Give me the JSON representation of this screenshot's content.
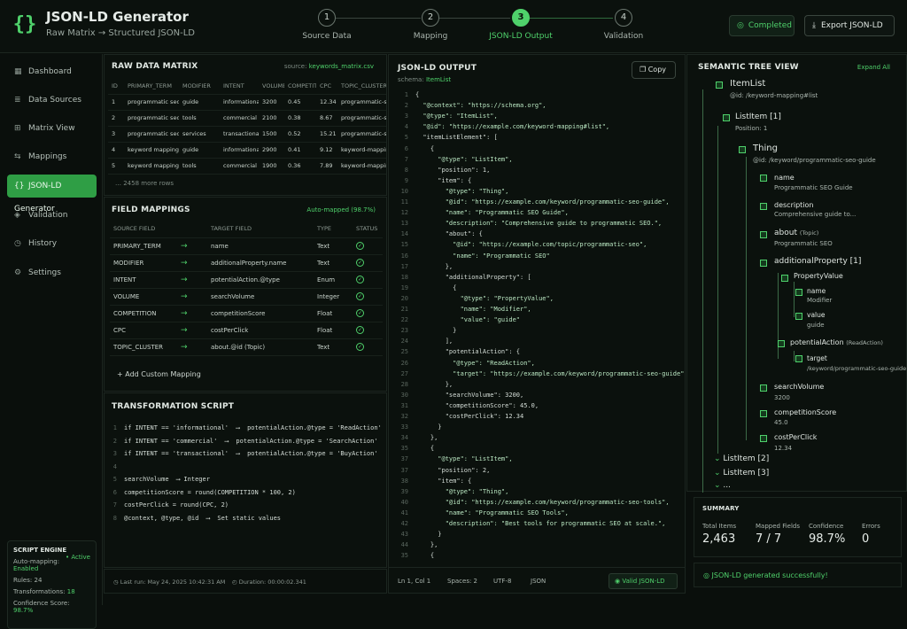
{
  "app": {
    "title": "JSON-LD Generator",
    "subtitle": "Raw Matrix → Structured JSON-LD",
    "logo": "{}"
  },
  "steps": [
    {
      "n": "1",
      "label": "Source Data"
    },
    {
      "n": "2",
      "label": "Mapping"
    },
    {
      "n": "3",
      "label": "JSON-LD Output"
    },
    {
      "n": "4",
      "label": "Validation"
    }
  ],
  "header": {
    "completed": "Completed",
    "export": "Export JSON-LD"
  },
  "nav": [
    {
      "label": "Dashboard",
      "icon": "grid-icon"
    },
    {
      "label": "Data Sources",
      "icon": "database-icon"
    },
    {
      "label": "Matrix View",
      "icon": "matrix-icon"
    },
    {
      "label": "Mappings",
      "icon": "sliders-icon"
    },
    {
      "label": "JSON-LD Generator",
      "icon": "braces-icon"
    },
    {
      "label": "Validation",
      "icon": "shield-icon"
    },
    {
      "label": "History",
      "icon": "history-icon"
    },
    {
      "label": "Settings",
      "icon": "gear-icon"
    }
  ],
  "engine": {
    "title": "SCRIPT ENGINE",
    "status": "• Active",
    "automapping_label": "Auto-mapping:",
    "automapping_value": "Enabled",
    "rules_label": "Rules:",
    "rules_value": "24",
    "transformations_label": "Transformations:",
    "transformations_value": "18",
    "confidence_label": "Confidence Score:",
    "confidence_value": "98.7%"
  },
  "raw": {
    "title": "RAW DATA MATRIX",
    "source_label": "source:",
    "source_file": "keywords_matrix.csv",
    "headers": [
      "ID",
      "PRIMARY_TERM",
      "MODIFIER",
      "INTENT",
      "VOLUME",
      "COMPETITION",
      "CPC",
      "TOPIC_CLUSTER"
    ],
    "rows": [
      [
        "1",
        "programmatic seo",
        "guide",
        "informational",
        "3200",
        "0.45",
        "12.34",
        "programmatic-seo"
      ],
      [
        "2",
        "programmatic seo",
        "tools",
        "commercial",
        "2100",
        "0.38",
        "8.67",
        "programmatic-seo"
      ],
      [
        "3",
        "programmatic seo",
        "services",
        "transactional",
        "1500",
        "0.52",
        "15.21",
        "programmatic-seo"
      ],
      [
        "4",
        "keyword mapping",
        "guide",
        "informational",
        "2900",
        "0.41",
        "9.12",
        "keyword-mapping"
      ],
      [
        "5",
        "keyword mapping",
        "tools",
        "commercial",
        "1900",
        "0.36",
        "7.89",
        "keyword-mapping"
      ]
    ],
    "more": "… 2458 more rows"
  },
  "mappings": {
    "title": "FIELD MAPPINGS",
    "status": "Auto-mapped (98.7%)",
    "headers": [
      "SOURCE FIELD",
      "",
      "TARGET FIELD",
      "TYPE",
      "STATUS"
    ],
    "rows": [
      [
        "PRIMARY_TERM",
        "name",
        "Text"
      ],
      [
        "MODIFIER",
        "additionalProperty.name",
        "Text"
      ],
      [
        "INTENT",
        "potentialAction.@type",
        "Enum"
      ],
      [
        "VOLUME",
        "searchVolume",
        "Integer"
      ],
      [
        "COMPETITION",
        "competitionScore",
        "Float"
      ],
      [
        "CPC",
        "costPerClick",
        "Float"
      ],
      [
        "TOPIC_CLUSTER",
        "about.@id (Topic)",
        "Text"
      ]
    ],
    "add": "+ Add Custom Mapping"
  },
  "script": {
    "title": "TRANSFORMATION SCRIPT",
    "lines": [
      "if INTENT == 'informational'  ⟶  potentialAction.@type = 'ReadAction'",
      "if INTENT == 'commercial'  ⟶  potentialAction.@type = 'SearchAction'",
      "if INTENT == 'transactional'  ⟶  potentialAction.@type = 'BuyAction'",
      "",
      "searchVolume  ⟶ Integer",
      "competitionScore = round(COMPETITION * 100, 2)",
      "costPerClick = round(CPC, 2)",
      "@context, @type, @id  ⟶  Set static values"
    ],
    "last_run": "Last run: May 24, 2025 10:42:31 AM",
    "duration": "Duration: 00:00:02.341"
  },
  "output": {
    "title": "JSON-LD OUTPUT",
    "schema_label": "schema:",
    "schema": "ItemList",
    "copy": "Copy",
    "lines": [
      [
        "1",
        "{"
      ],
      [
        "2",
        "  \"@context\": \"https://schema.org\","
      ],
      [
        "3",
        "  \"@type\": \"ItemList\","
      ],
      [
        "4",
        "  \"@id\": \"https://example.com/keyword-mapping#list\","
      ],
      [
        "5",
        "  \"itemListElement\": ["
      ],
      [
        "6",
        "    {"
      ],
      [
        "7",
        "      \"@type\": \"ListItem\","
      ],
      [
        "8",
        "      \"position\": 1,"
      ],
      [
        "9",
        "      \"item\": {"
      ],
      [
        "10",
        "        \"@type\": \"Thing\","
      ],
      [
        "11",
        "        \"@id\": \"https://example.com/keyword/programmatic-seo-guide\","
      ],
      [
        "12",
        "        \"name\": \"Programmatic SEO Guide\","
      ],
      [
        "13",
        "        \"description\": \"Comprehensive guide to programmatic SEO.\","
      ],
      [
        "14",
        "        \"about\": {"
      ],
      [
        "15",
        "          \"@id\": \"https://example.com/topic/programmatic-seo\","
      ],
      [
        "16",
        "          \"name\": \"Programmatic SEO\""
      ],
      [
        "17",
        "        },"
      ],
      [
        "18",
        "        \"additionalProperty\": ["
      ],
      [
        "19",
        "          {"
      ],
      [
        "20",
        "            \"@type\": \"PropertyValue\","
      ],
      [
        "21",
        "            \"name\": \"Modifier\","
      ],
      [
        "22",
        "            \"value\": \"guide\""
      ],
      [
        "23",
        "          }"
      ],
      [
        "24",
        "        ],"
      ],
      [
        "25",
        "        \"potentialAction\": {"
      ],
      [
        "26",
        "          \"@type\": \"ReadAction\","
      ],
      [
        "27",
        "          \"target\": \"https://example.com/keyword/programmatic-seo-guide\""
      ],
      [
        "28",
        "        },"
      ],
      [
        "30",
        "        \"searchVolume\": 3200,"
      ],
      [
        "31",
        "        \"competitionScore\": 45.0,"
      ],
      [
        "32",
        "        \"costPerClick\": 12.34"
      ],
      [
        "33",
        "      }"
      ],
      [
        "34",
        "    },"
      ],
      [
        "35",
        "    {"
      ],
      [
        "37",
        "      \"@type\": \"ListItem\","
      ],
      [
        "37",
        "      \"position\": 2,"
      ],
      [
        "38",
        "      \"item\": {"
      ],
      [
        "39",
        "        \"@type\": \"Thing\","
      ],
      [
        "40",
        "        \"@id\": \"https://example.com/keyword/programmatic-seo-tools\","
      ],
      [
        "41",
        "        \"name\": \"Programmatic SEO Tools\","
      ],
      [
        "42",
        "        \"description\": \"Best tools for programmatic SEO at scale.\","
      ],
      [
        "43",
        "      }"
      ],
      [
        "44",
        "    },"
      ],
      [
        "35",
        "    {"
      ]
    ],
    "status": {
      "pos": "Ln 1, Col 1",
      "spaces": "Spaces: 2",
      "enc": "UTF-8",
      "lang": "JSON",
      "valid": "Valid JSON-LD"
    }
  },
  "tree": {
    "title": "SEMANTIC TREE VIEW",
    "expand": "Expand All",
    "root": {
      "label": "ItemList",
      "sub": "@id: /keyword-mapping#list"
    },
    "listitem1": {
      "label": "ListItem [1]",
      "sub": "Position: 1"
    },
    "thing": {
      "label": "Thing",
      "sub": "@id: /keyword/programmatic-seo-guide"
    },
    "name": {
      "label": "name",
      "sub": "Programmatic SEO Guide"
    },
    "description": {
      "label": "description",
      "sub": "Comprehensive guide to..."
    },
    "about": {
      "label": "about",
      "tag": "(Topic)",
      "sub": "Programmatic SEO"
    },
    "addprop": {
      "label": "additionalProperty [1]"
    },
    "propval": {
      "label": "PropertyValue"
    },
    "pv_name": {
      "label": "name",
      "sub": "Modifier"
    },
    "pv_value": {
      "label": "value",
      "sub": "guide"
    },
    "action": {
      "label": "potentialAction",
      "tag": "(ReadAction)"
    },
    "target": {
      "label": "target",
      "sub": "/keyword/programmatic-seo-guide"
    },
    "volume": {
      "label": "searchVolume",
      "sub": "3200"
    },
    "comp": {
      "label": "competitionScore",
      "sub": "45.0"
    },
    "cpc": {
      "label": "costPerClick",
      "sub": "12.34"
    },
    "li2": "ListItem [2]",
    "li3": "ListItem [3]",
    "more": "..."
  },
  "summary": {
    "title": "SUMMARY",
    "stats": [
      {
        "label": "Total Items",
        "value": "2,463"
      },
      {
        "label": "Mapped Fields",
        "value": "7 / 7"
      },
      {
        "label": "Confidence",
        "value": "98.7%"
      },
      {
        "label": "Errors",
        "value": "0"
      }
    ],
    "success": "JSON-LD generated successfully!"
  }
}
